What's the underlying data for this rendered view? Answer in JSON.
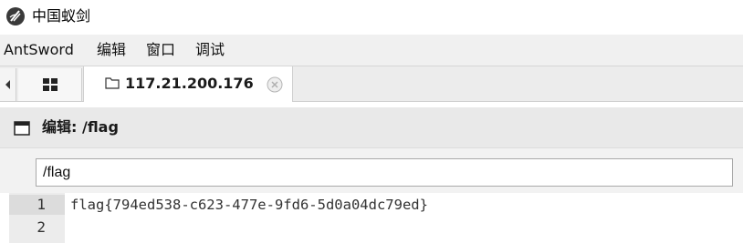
{
  "window": {
    "title": "中国蚁剑",
    "icon": "antsword-logo-icon"
  },
  "menu": {
    "items": [
      "AntSword",
      "编辑",
      "窗口",
      "调试"
    ]
  },
  "tabs": {
    "home_icon": "grid-icon",
    "session": {
      "label": "117.21.200.176",
      "icon": "folder-icon",
      "close_icon": "close-circle-icon"
    }
  },
  "panel": {
    "title": "编辑: /flag",
    "icon": "window-icon"
  },
  "path_input": {
    "value": "/flag"
  },
  "editor": {
    "lines": [
      {
        "number": "1",
        "text": "flag{794ed538-c623-477e-9fd6-5d0a04dc79ed}"
      },
      {
        "number": "2",
        "text": ""
      }
    ]
  }
}
